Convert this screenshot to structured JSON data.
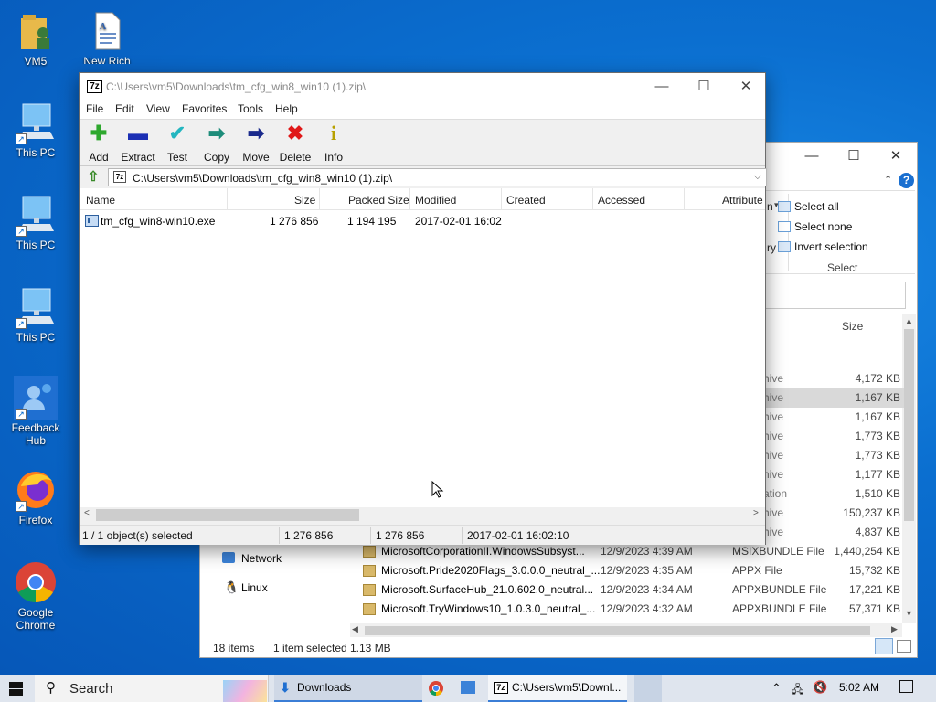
{
  "desktop": {
    "icons": [
      {
        "label": "VM5",
        "icon": "user-folder-icon"
      },
      {
        "label": "New Rich Text Document",
        "icon": "rich-text-document-icon"
      },
      {
        "label": "This PC",
        "icon": "computer-icon"
      },
      {
        "label": "This PC",
        "icon": "computer-icon"
      },
      {
        "label": "This PC",
        "icon": "computer-icon"
      },
      {
        "label": "Feedback Hub",
        "icon": "feedback-hub-icon"
      },
      {
        "label": "Firefox",
        "icon": "firefox-icon"
      },
      {
        "label": "Google Chrome",
        "icon": "chrome-icon"
      }
    ]
  },
  "explorer": {
    "ribbon": {
      "select_all": "Select all",
      "select_none": "Select none",
      "invert_selection": "Invert selection",
      "group_label": "Select",
      "partial_left": "n",
      "partial_left2": "ry"
    },
    "column_size": "Size",
    "rows": [
      {
        "name": "",
        "date": "",
        "type": "hive",
        "size": "4,172 KB"
      },
      {
        "name": "",
        "date": "",
        "type": "hive",
        "size": "1,167 KB"
      },
      {
        "name": "",
        "date": "",
        "type": "hive",
        "size": "1,167 KB"
      },
      {
        "name": "",
        "date": "",
        "type": "hive",
        "size": "1,773 KB"
      },
      {
        "name": "",
        "date": "",
        "type": "hive",
        "size": "1,773 KB"
      },
      {
        "name": "",
        "date": "",
        "type": "hive",
        "size": "1,177 KB"
      },
      {
        "name": "",
        "date": "",
        "type": "ation",
        "size": "1,510 KB"
      },
      {
        "name": "",
        "date": "",
        "type": "hive",
        "size": "150,237 KB"
      },
      {
        "name": "",
        "date": "",
        "type": "hive",
        "size": "4,837 KB"
      },
      {
        "name": "MicrosoftCorporationII.WindowsSubsyst...",
        "date": "12/9/2023 4:39 AM",
        "type": "MSIXBUNDLE File",
        "size": "1,440,254 KB"
      },
      {
        "name": "Microsoft.Pride2020Flags_3.0.0.0_neutral_...",
        "date": "12/9/2023 4:35 AM",
        "type": "APPX File",
        "size": "15,732 KB"
      },
      {
        "name": "Microsoft.SurfaceHub_21.0.602.0_neutral...",
        "date": "12/9/2023 4:34 AM",
        "type": "APPXBUNDLE File",
        "size": "17,221 KB"
      },
      {
        "name": "Microsoft.TryWindows10_1.0.3.0_neutral_...",
        "date": "12/9/2023 4:32 AM",
        "type": "APPXBUNDLE File",
        "size": "57,371 KB"
      }
    ],
    "nav": {
      "network": "Network",
      "linux": "Linux"
    },
    "status": {
      "items": "18 items",
      "selected": "1 item selected",
      "size": "1.13 MB"
    }
  },
  "sevenzip": {
    "title": "C:\\Users\\vm5\\Downloads\\tm_cfg_win8_win10 (1).zip\\",
    "menu": [
      "File",
      "Edit",
      "View",
      "Favorites",
      "Tools",
      "Help"
    ],
    "toolbar": [
      {
        "label": "Add",
        "icon": "add-icon"
      },
      {
        "label": "Extract",
        "icon": "extract-icon"
      },
      {
        "label": "Test",
        "icon": "test-icon"
      },
      {
        "label": "Copy",
        "icon": "copy-icon"
      },
      {
        "label": "Move",
        "icon": "move-icon"
      },
      {
        "label": "Delete",
        "icon": "delete-icon"
      },
      {
        "label": "Info",
        "icon": "info-icon"
      }
    ],
    "address": "C:\\Users\\vm5\\Downloads\\tm_cfg_win8_win10 (1).zip\\",
    "columns": [
      "Name",
      "Size",
      "Packed Size",
      "Modified",
      "Created",
      "Accessed",
      "Attribute"
    ],
    "file": {
      "name": "tm_cfg_win8-win10.exe",
      "size": "1 276 856",
      "packed": "1 194 195",
      "modified": "2017-02-01 16:02"
    },
    "status": {
      "selection": "1 / 1 object(s) selected",
      "size": "1 276 856",
      "packed": "1 276 856",
      "modified": "2017-02-01 16:02:10"
    }
  },
  "taskbar": {
    "search_placeholder": "Search",
    "downloads": "Downloads",
    "sevenzip_task": "C:\\Users\\vm5\\Downl...",
    "time": "5:02 AM"
  },
  "colors": {
    "desktop": "#0b6fd0",
    "accent": "#3b7ed6",
    "selection": "#d9d9d9"
  }
}
